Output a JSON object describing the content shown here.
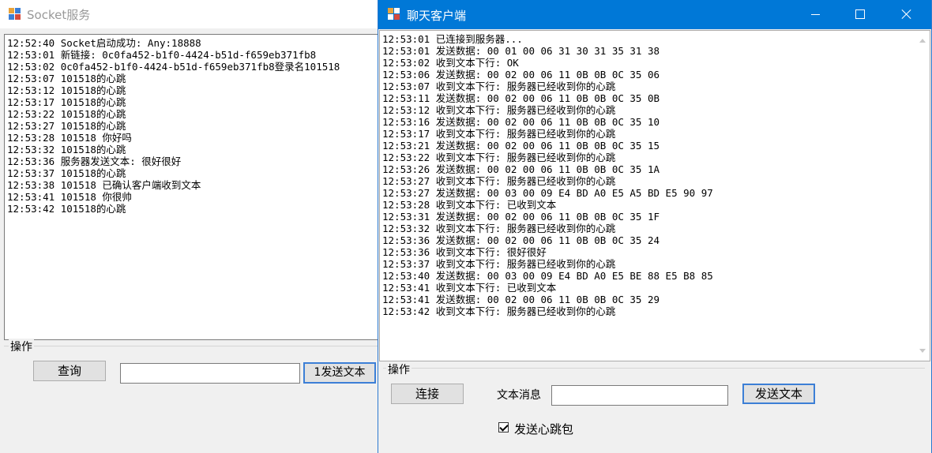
{
  "server": {
    "title": "Socket服务",
    "log": [
      "12:52:40 Socket启动成功: Any:18888",
      "12:53:01 新链接: 0c0fa452-b1f0-4424-b51d-f659eb371fb8",
      "12:53:02 0c0fa452-b1f0-4424-b51d-f659eb371fb8登录名101518",
      "12:53:07 101518的心跳",
      "12:53:12 101518的心跳",
      "12:53:17 101518的心跳",
      "12:53:22 101518的心跳",
      "12:53:27 101518的心跳",
      "12:53:28 101518 你好吗",
      "12:53:32 101518的心跳",
      "12:53:36 服务器发送文本: 很好很好",
      "12:53:37 101518的心跳",
      "12:53:38 101518 已确认客户端收到文本",
      "12:53:41 101518 你很帅",
      "12:53:42 101518的心跳"
    ],
    "group_label": "操作",
    "query_label": "查询",
    "text_value": "",
    "send_label": "1发送文本"
  },
  "client": {
    "title": "聊天客户端",
    "log": [
      "12:53:01 已连接到服务器...",
      "12:53:01 发送数据: 00 01 00 06 31 30 31 35 31 38",
      "12:53:02 收到文本下行: OK",
      "12:53:06 发送数据: 00 02 00 06 11 0B 0B 0C 35 06",
      "12:53:07 收到文本下行: 服务器已经收到你的心跳",
      "12:53:11 发送数据: 00 02 00 06 11 0B 0B 0C 35 0B",
      "12:53:12 收到文本下行: 服务器已经收到你的心跳",
      "12:53:16 发送数据: 00 02 00 06 11 0B 0B 0C 35 10",
      "12:53:17 收到文本下行: 服务器已经收到你的心跳",
      "12:53:21 发送数据: 00 02 00 06 11 0B 0B 0C 35 15",
      "12:53:22 收到文本下行: 服务器已经收到你的心跳",
      "12:53:26 发送数据: 00 02 00 06 11 0B 0B 0C 35 1A",
      "12:53:27 收到文本下行: 服务器已经收到你的心跳",
      "12:53:27 发送数据: 00 03 00 09 E4 BD A0 E5 A5 BD E5 90 97",
      "12:53:28 收到文本下行: 已收到文本",
      "12:53:31 发送数据: 00 02 00 06 11 0B 0B 0C 35 1F",
      "12:53:32 收到文本下行: 服务器已经收到你的心跳",
      "12:53:36 发送数据: 00 02 00 06 11 0B 0B 0C 35 24",
      "12:53:36 收到文本下行: 很好很好",
      "12:53:37 收到文本下行: 服务器已经收到你的心跳",
      "12:53:40 发送数据: 00 03 00 09 E4 BD A0 E5 BE 88 E5 B8 85",
      "12:53:41 收到文本下行: 已收到文本",
      "12:53:41 发送数据: 00 02 00 06 11 0B 0B 0C 35 29",
      "12:53:42 收到文本下行: 服务器已经收到你的心跳"
    ],
    "group_label": "操作",
    "connect_label": "连接",
    "message_label": "文本消息",
    "text_value": "",
    "send_label": "发送文本",
    "heartbeat_label": "发送心跳包",
    "heartbeat_checked": true
  }
}
